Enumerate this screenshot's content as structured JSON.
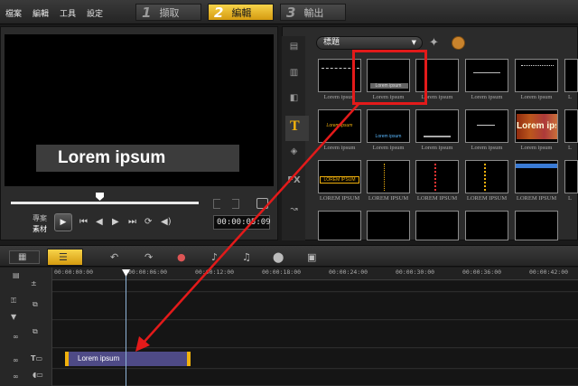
{
  "menu": [
    "檔案",
    "編輯",
    "工具",
    "設定"
  ],
  "steps": [
    {
      "num": "1",
      "label": "擷取",
      "active": false
    },
    {
      "num": "2",
      "label": "編輯",
      "active": true
    },
    {
      "num": "3",
      "label": "輸出",
      "active": false
    }
  ],
  "preview": {
    "caption": "Lorem ipsum",
    "mode_project": "專案",
    "mode_clip": "素材",
    "timecode": "00:00:05:09"
  },
  "library": {
    "category": "標題",
    "thumb_labels": [
      [
        "Lorem ipsum",
        "Lorem ipsum",
        "Lorem ipsum",
        "Lorem ipsum",
        "Lorem ipsum",
        "L"
      ],
      [
        "Lorem ipsum",
        "Lorem ipsum",
        "Lorem ipsum",
        "Lorem ipsum",
        "Lorem ipsum",
        "L"
      ],
      [
        "LOREM IPSUM",
        "LOREM IPSUM",
        "LOREM IPSUM",
        "LOREM IPSUM",
        "LOREM IPSUM",
        "L"
      ]
    ],
    "thumb_texts": {
      "r1c2": "Lorem ipsum",
      "r2c1": "Lorem ipsum",
      "r2c2": "Lorem ipsum",
      "r2c6": "Lorem ipsum",
      "r3c1": "LOREM IPSUM"
    }
  },
  "timeline": {
    "ruler": [
      "00:00:00:00",
      "00:00:06:00",
      "00:00:12:00",
      "00:00:18:00",
      "00:00:24:00",
      "00:00:30:00",
      "00:00:36:00",
      "00:00:42:00"
    ],
    "title_clip": "Lorem ipsum"
  },
  "colors": {
    "accent_yellow": "#f1b10d",
    "highlight_red": "#e31a1a",
    "clip_purple": "#4e4a86"
  }
}
